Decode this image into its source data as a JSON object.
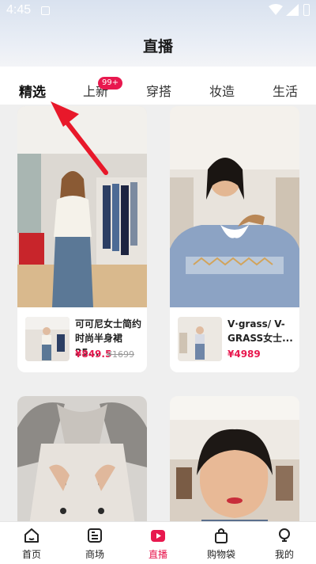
{
  "status_bar": {
    "time": "4:45"
  },
  "header": {
    "title": "直播"
  },
  "tabs": [
    {
      "label": "精选",
      "active": true
    },
    {
      "label": "上新",
      "badge": "99+"
    },
    {
      "label": "穿搭"
    },
    {
      "label": "妆造"
    },
    {
      "label": "生活"
    }
  ],
  "cards": [
    {
      "product_name": "可可尼女士简约时尚半身裙25...",
      "price": "¥849.5",
      "original_price": "¥1699"
    },
    {
      "product_name": "V·grass/ V-GRASS女士...",
      "price": "¥4989"
    },
    {},
    {}
  ],
  "bottom_nav": [
    {
      "label": "首页",
      "icon": "home-icon"
    },
    {
      "label": "商场",
      "icon": "mall-icon"
    },
    {
      "label": "直播",
      "icon": "live-icon",
      "active": true
    },
    {
      "label": "购物袋",
      "icon": "shopping-bag-icon"
    },
    {
      "label": "我的",
      "icon": "profile-icon"
    }
  ],
  "colors": {
    "accent": "#e8184e",
    "arrow": "#e8182a"
  }
}
